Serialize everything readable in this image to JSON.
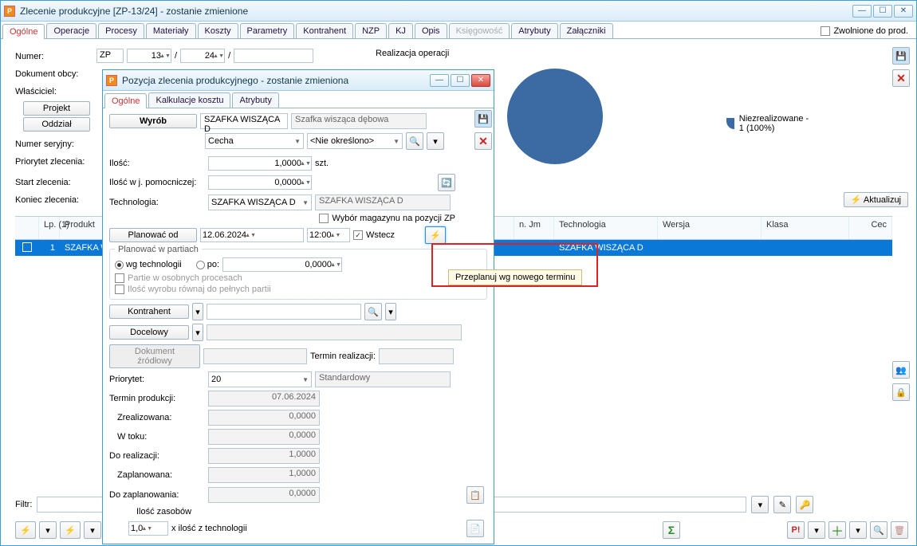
{
  "main": {
    "title": "Zlecenie produkcyjne  [ZP-13/24] - zostanie zmienione",
    "tabs": [
      "Ogólne",
      "Operacje",
      "Procesy",
      "Materiały",
      "Koszty",
      "Parametry",
      "Kontrahent",
      "NZP",
      "KJ",
      "Opis",
      "Księgowość",
      "Atrybuty",
      "Załączniki"
    ],
    "release_checkbox": "Zwolnione do prod.",
    "labels": {
      "numer": "Numer:",
      "dokument_obcy": "Dokument obcy:",
      "wlasciciel": "Właściciel:",
      "projekt": "Projekt",
      "oddzial": "Oddział",
      "numer_seryjny": "Numer seryjny:",
      "priorytet": "Priorytet zlecenia:",
      "start": "Start zlecenia:",
      "koniec": "Koniec zlecenia:"
    },
    "numer_prefix": "ZP",
    "numer_1": "13",
    "numer_2": "24",
    "numer_slash": "/",
    "realizacja": "Realizacja operacji",
    "chart": {
      "legend": "Niezrealizowane - 1 (100%)"
    },
    "aktualizuj": "Aktualizuj",
    "grid": {
      "headers": {
        "lp": "Lp.",
        "lp_count": "(1)",
        "produkt": "Produkt",
        "jm": "n. Jm",
        "technologia": "Technologia",
        "wersja": "Wersja",
        "klasa": "Klasa",
        "cecha": "Cec"
      },
      "row": {
        "lp": "1",
        "produkt": "SZAFKA WIS",
        "technologia": "SZAFKA WISZĄCA D"
      }
    },
    "filter_label": "Filtr:"
  },
  "sub": {
    "title": "Pozycja zlecenia produkcyjnego - zostanie zmieniona",
    "tabs": [
      "Ogólne",
      "Kalkulacje kosztu",
      "Atrybuty"
    ],
    "wyrob_btn": "Wyrób",
    "wyrob_code": "SZAFKA WISZĄCA D",
    "wyrob_name": "Szafka wisząca dębowa",
    "cecha_label": "Cecha",
    "cecha_value": "<Nie określono>",
    "ilosc_lbl": "Ilość:",
    "ilosc_val": "1,0000",
    "ilosc_unit": "szt.",
    "ilosc_pom_lbl": "Ilość w j. pomocniczej:",
    "ilosc_pom_val": "0,0000",
    "tech_lbl": "Technologia:",
    "tech_code": "SZAFKA WISZĄCA D",
    "tech_name": "SZAFKA WISZĄCA D",
    "wyb_mag": "Wybór magazynu na pozycji ZP",
    "planowac_od": "Planować od",
    "date": "12.06.2024",
    "time": "12:00",
    "wstecz": "Wstecz",
    "partie_group": "Planować w partiach",
    "wg_tech": "wg technologii",
    "po": "po:",
    "po_val": "0,0000",
    "partie_osob": "Partie w osobnych procesach",
    "il_wyrobu": "Ilość wyrobu równaj do pełnych partii",
    "kontrahent": "Kontrahent",
    "docelowy": "Docelowy",
    "dok_zrodlowy": "Dokument źródłowy",
    "termin_real": "Termin realizacji:",
    "priorytet": "Priorytet:",
    "priorytet_val": "20",
    "priorytet_name": "Standardowy",
    "termin_prod": "Termin produkcji:",
    "termin_prod_val": "07.06.2024",
    "zreal": "Zrealizowana:",
    "zreal_val": "0,0000",
    "wtoku": "W toku:",
    "wtoku_val": "0,0000",
    "doreal": "Do realizacji:",
    "doreal_val": "1,0000",
    "zaplan": "Zaplanowana:",
    "zaplan_val": "1,0000",
    "dozaplan": "Do zaplanowania:",
    "dozaplan_val": "0,0000",
    "il_zasob": "Ilość zasobów",
    "il_zasob_val": "1,0",
    "il_z_tech": "x ilość z technologii"
  },
  "tooltip": "Przeplanuj wg nowego terminu",
  "chart_data": {
    "type": "pie",
    "title": "Realizacja operacji",
    "series": [
      {
        "name": "Niezrealizowane",
        "value": 1,
        "percent": 100,
        "color": "#3c6ba3"
      }
    ]
  }
}
